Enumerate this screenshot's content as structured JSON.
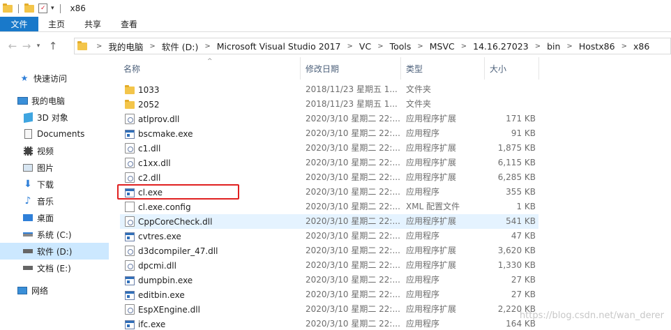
{
  "window": {
    "title": "x86"
  },
  "ribbon": {
    "tabs": [
      "文件",
      "主页",
      "共享",
      "查看"
    ]
  },
  "breadcrumb": [
    "我的电脑",
    "软件 (D:)",
    "Microsoft Visual Studio 2017",
    "VC",
    "Tools",
    "MSVC",
    "14.16.27023",
    "bin",
    "Hostx86",
    "x86"
  ],
  "nav": {
    "items": [
      {
        "label": "快速访问",
        "icon": "star-icon"
      },
      {
        "label": "我的电脑",
        "icon": "computer-icon"
      },
      {
        "label": "3D 对象",
        "icon": "3d-objects-icon"
      },
      {
        "label": "Documents",
        "icon": "documents-icon"
      },
      {
        "label": "视频",
        "icon": "video-icon"
      },
      {
        "label": "图片",
        "icon": "pictures-icon"
      },
      {
        "label": "下载",
        "icon": "download-icon"
      },
      {
        "label": "音乐",
        "icon": "music-icon"
      },
      {
        "label": "桌面",
        "icon": "desktop-icon"
      },
      {
        "label": "系统 (C:)",
        "icon": "drive-icon"
      },
      {
        "label": "软件 (D:)",
        "icon": "drive-icon"
      },
      {
        "label": "文档 (E:)",
        "icon": "drive-icon"
      },
      {
        "label": "网络",
        "icon": "network-icon"
      }
    ]
  },
  "columns": {
    "name": "名称",
    "date": "修改日期",
    "type": "类型",
    "size": "大小"
  },
  "files": [
    {
      "name": "1033",
      "date": "2018/11/23 星期五 1...",
      "type": "文件夹",
      "size": "",
      "icon": "folder-icon"
    },
    {
      "name": "2052",
      "date": "2018/11/23 星期五 1...",
      "type": "文件夹",
      "size": "",
      "icon": "folder-icon"
    },
    {
      "name": "atlprov.dll",
      "date": "2020/3/10 星期二 22:...",
      "type": "应用程序扩展",
      "size": "171 KB",
      "icon": "dll-icon"
    },
    {
      "name": "bscmake.exe",
      "date": "2020/3/10 星期二 22:...",
      "type": "应用程序",
      "size": "91 KB",
      "icon": "exe-icon"
    },
    {
      "name": "c1.dll",
      "date": "2020/3/10 星期二 22:...",
      "type": "应用程序扩展",
      "size": "1,875 KB",
      "icon": "dll-icon"
    },
    {
      "name": "c1xx.dll",
      "date": "2020/3/10 星期二 22:...",
      "type": "应用程序扩展",
      "size": "6,115 KB",
      "icon": "dll-icon"
    },
    {
      "name": "c2.dll",
      "date": "2020/3/10 星期二 22:...",
      "type": "应用程序扩展",
      "size": "6,285 KB",
      "icon": "dll-icon"
    },
    {
      "name": "cl.exe",
      "date": "2020/3/10 星期二 22:...",
      "type": "应用程序",
      "size": "355 KB",
      "icon": "exe-icon"
    },
    {
      "name": "cl.exe.config",
      "date": "2020/3/10 星期二 22:...",
      "type": "XML 配置文件",
      "size": "1 KB",
      "icon": "config-file-icon"
    },
    {
      "name": "CppCoreCheck.dll",
      "date": "2020/3/10 星期二 22:...",
      "type": "应用程序扩展",
      "size": "541 KB",
      "icon": "dll-icon"
    },
    {
      "name": "cvtres.exe",
      "date": "2020/3/10 星期二 22:...",
      "type": "应用程序",
      "size": "47 KB",
      "icon": "exe-icon"
    },
    {
      "name": "d3dcompiler_47.dll",
      "date": "2020/3/10 星期二 22:...",
      "type": "应用程序扩展",
      "size": "3,620 KB",
      "icon": "dll-icon"
    },
    {
      "name": "dpcmi.dll",
      "date": "2020/3/10 星期二 22:...",
      "type": "应用程序扩展",
      "size": "1,330 KB",
      "icon": "dll-icon"
    },
    {
      "name": "dumpbin.exe",
      "date": "2020/3/10 星期二 22:...",
      "type": "应用程序",
      "size": "27 KB",
      "icon": "exe-icon"
    },
    {
      "name": "editbin.exe",
      "date": "2020/3/10 星期二 22:...",
      "type": "应用程序",
      "size": "27 KB",
      "icon": "exe-icon"
    },
    {
      "name": "EspXEngine.dll",
      "date": "2020/3/10 星期二 22:...",
      "type": "应用程序扩展",
      "size": "2,220 KB",
      "icon": "dll-icon"
    },
    {
      "name": "ifc.exe",
      "date": "2020/3/10 星期二 22:...",
      "type": "应用程序",
      "size": "164 KB",
      "icon": "exe-icon"
    }
  ],
  "highlighted_file": "cl.exe",
  "hovered_file": "CppCoreCheck.dll",
  "watermark": "https://blog.csdn.net/wan_derer",
  "colors": {
    "accent": "#1979ca",
    "selection": "#cce8ff",
    "hover": "#e5f3ff",
    "highlight": "#e02020"
  }
}
